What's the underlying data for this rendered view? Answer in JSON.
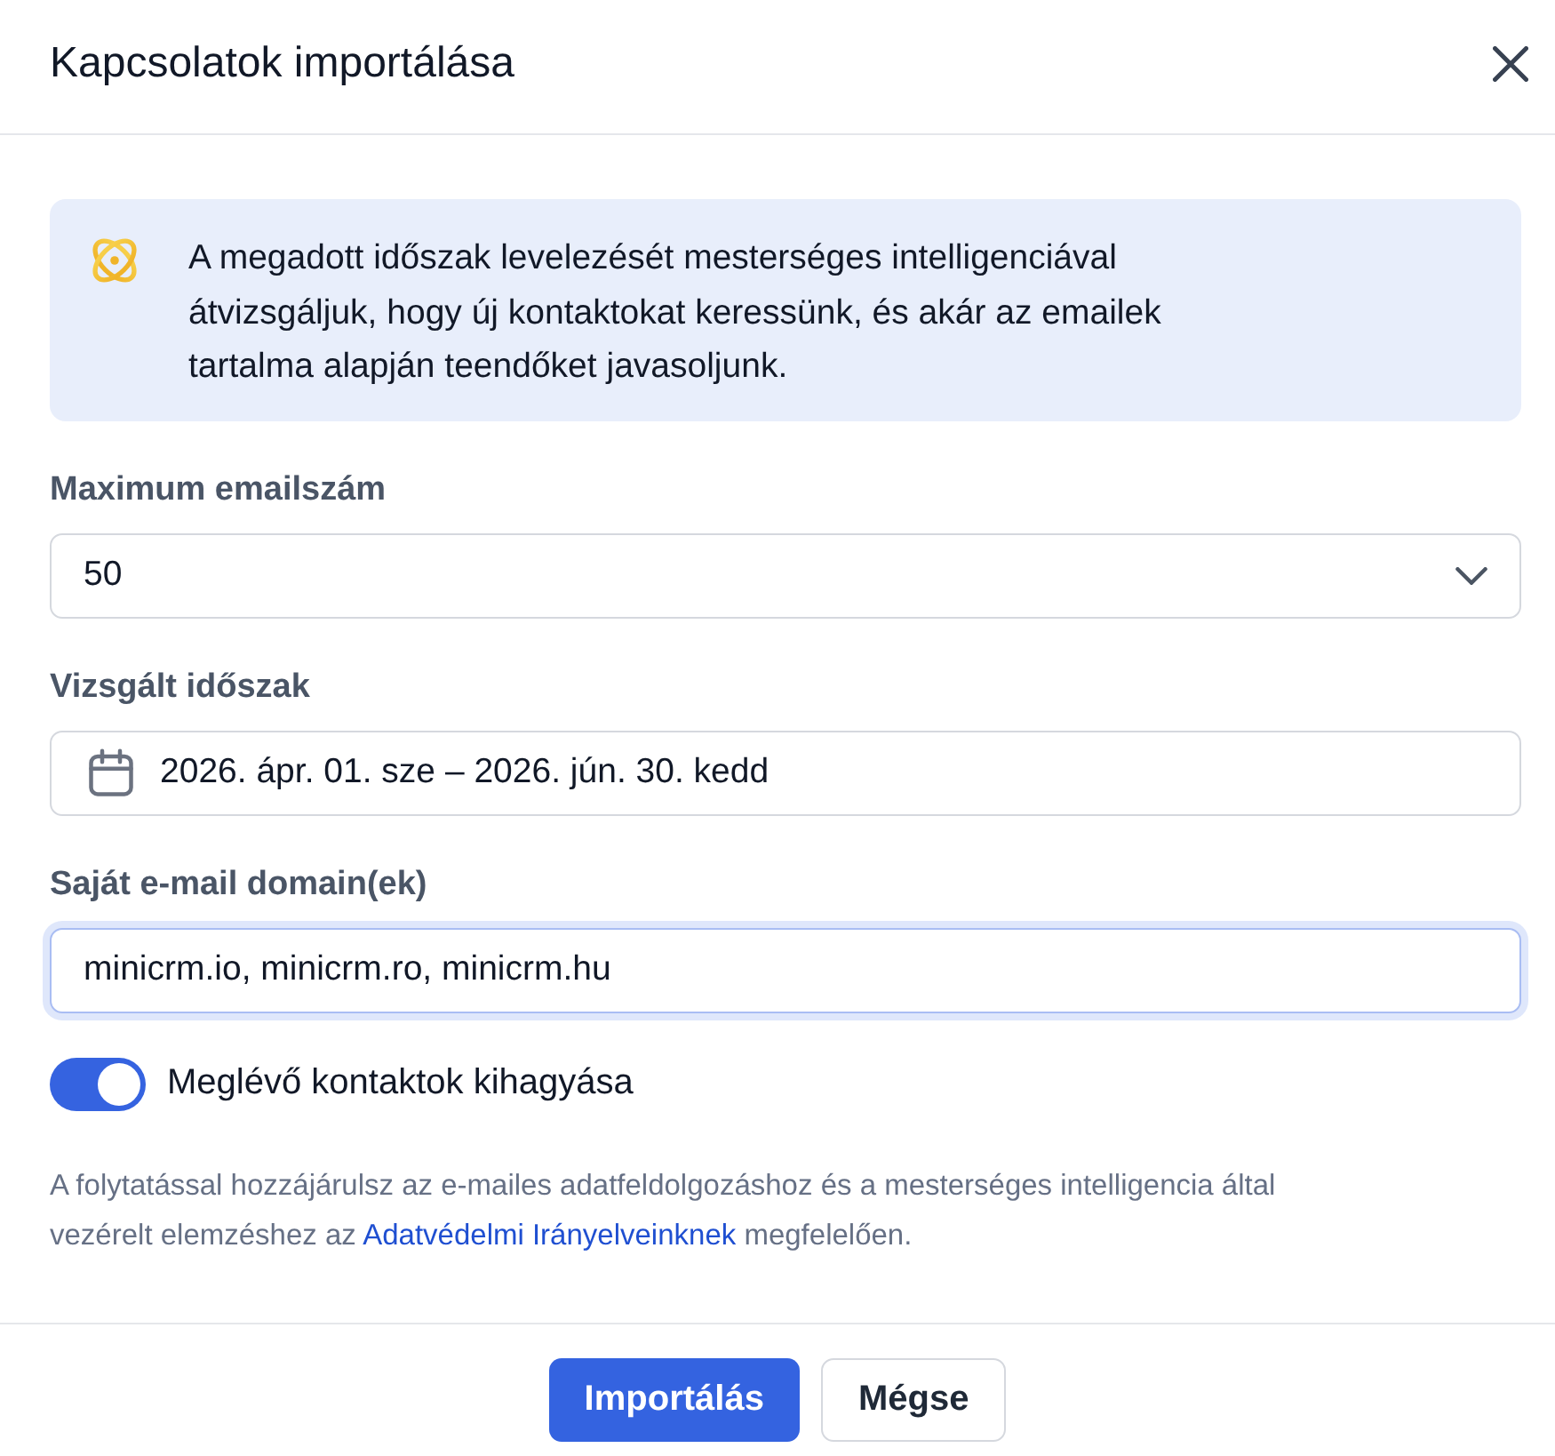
{
  "dialog": {
    "title": "Kapcsolatok importálása"
  },
  "info": {
    "text": "A megadott időszak levelezését mesterséges intelligenciával átvizsgáljuk, hogy új kontaktokat keressünk, és akár az emailek tartalma alapján teendőket javasoljunk."
  },
  "fields": [
    {
      "kind": "select",
      "label": "Maximum emailszám",
      "value": "50",
      "focused": false
    },
    {
      "kind": "date",
      "label": "Vizsgált időszak",
      "value": "2026. ápr. 01. sze – 2026. jún. 30. kedd",
      "focused": false
    },
    {
      "kind": "text",
      "label": "Saját e-mail domain(ek)",
      "value": "minicrm.io, minicrm.ro, minicrm.hu",
      "focused": true
    }
  ],
  "toggle": {
    "label": "Meglévő kontaktok kihagyása",
    "on": true
  },
  "consent": {
    "before": "A folytatással hozzájárulsz az e-mailes adatfeldolgozáshoz és a mesterséges intelligencia által vezérelt elemzéshez az",
    "link": "Adatvédelmi Irányelveinknek",
    "after": "megfelelően."
  },
  "buttons": [
    {
      "label": "Importálás",
      "primary": true
    },
    {
      "label": "Mégse",
      "primary": false
    }
  ]
}
